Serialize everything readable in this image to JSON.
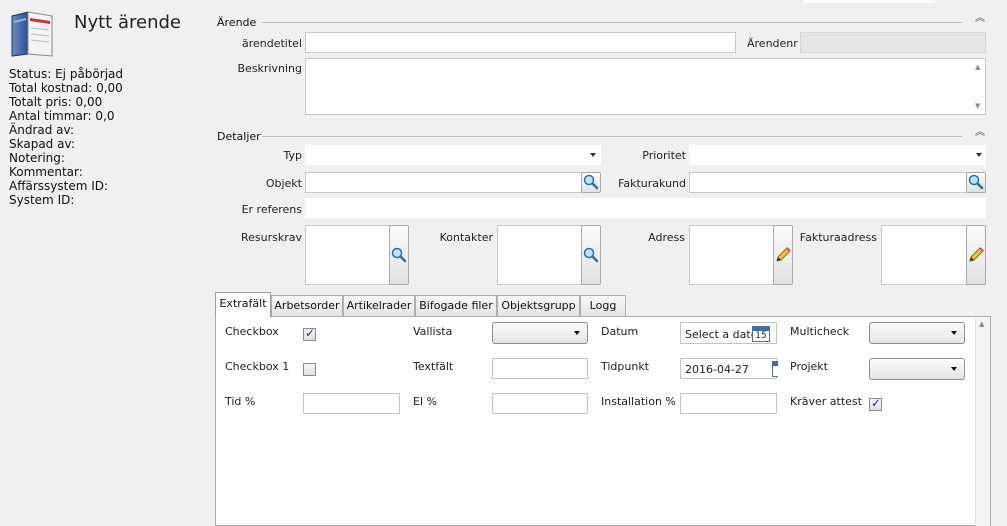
{
  "left": {
    "title": "Nytt ärende",
    "status_lines": [
      "Status: Ej påbörjad",
      "Total kostnad: 0,00",
      "Totalt pris: 0,00",
      "Antal timmar: 0,0",
      "Ändrad av:",
      "Skapad av:",
      "Notering:",
      "Kommentar:",
      "Affärssystem ID:",
      "System ID:"
    ]
  },
  "arende": {
    "section_title": "Ärende",
    "title_label": "ärendetitel",
    "title_value": "",
    "nr_label": "Ärendenr",
    "nr_value": "",
    "desc_label": "Beskrivning",
    "desc_value": ""
  },
  "detaljer": {
    "section_title": "Detaljer",
    "typ_label": "Typ",
    "typ_value": "",
    "prioritet_label": "Prioritet",
    "prioritet_value": "",
    "objekt_label": "Objekt",
    "objekt_value": "",
    "fakturakund_label": "Fakturakund",
    "fakturakund_value": "",
    "er_referens_label": "Er referens",
    "er_referens_value": "",
    "resurskrav_label": "Resurskrav",
    "kontakter_label": "Kontakter",
    "adress_label": "Adress",
    "fakturaadress_label": "Fakturaadress"
  },
  "tabs": [
    {
      "label": "Extrafält",
      "active": true
    },
    {
      "label": "Arbetsorder",
      "active": false
    },
    {
      "label": "Artikelrader",
      "active": false
    },
    {
      "label": "Bifogade filer",
      "active": false
    },
    {
      "label": "Objektsgrupp",
      "active": false
    },
    {
      "label": "Logg",
      "active": false
    }
  ],
  "extrafalt": {
    "checkbox_label": "Checkbox",
    "checkbox_checked": true,
    "checkbox1_label": "Checkbox 1",
    "checkbox1_checked": false,
    "tid_label": "Tid %",
    "tid_value": "",
    "vallista_label": "Vallista",
    "vallista_value": "",
    "textfalt_label": "Textfält",
    "textfalt_value": "",
    "el_label": "El %",
    "el_value": "",
    "datum_label": "Datum",
    "datum_placeholder": "Select a date",
    "tidpunkt_label": "Tidpunkt",
    "tidpunkt_value": "2016-04-27",
    "installation_label": "Installation %",
    "installation_value": "",
    "multicheck_label": "Multicheck",
    "projekt_label": "Projekt",
    "kraver_attest_label": "Kräver attest",
    "kraver_attest_checked": true,
    "calendar_day": "15"
  },
  "icons": {
    "collapse": "double-chevron-up-icon",
    "lookup": "magnifier-icon",
    "edit": "pencil-icon",
    "calendar": "calendar-icon",
    "app": "book-icon"
  }
}
